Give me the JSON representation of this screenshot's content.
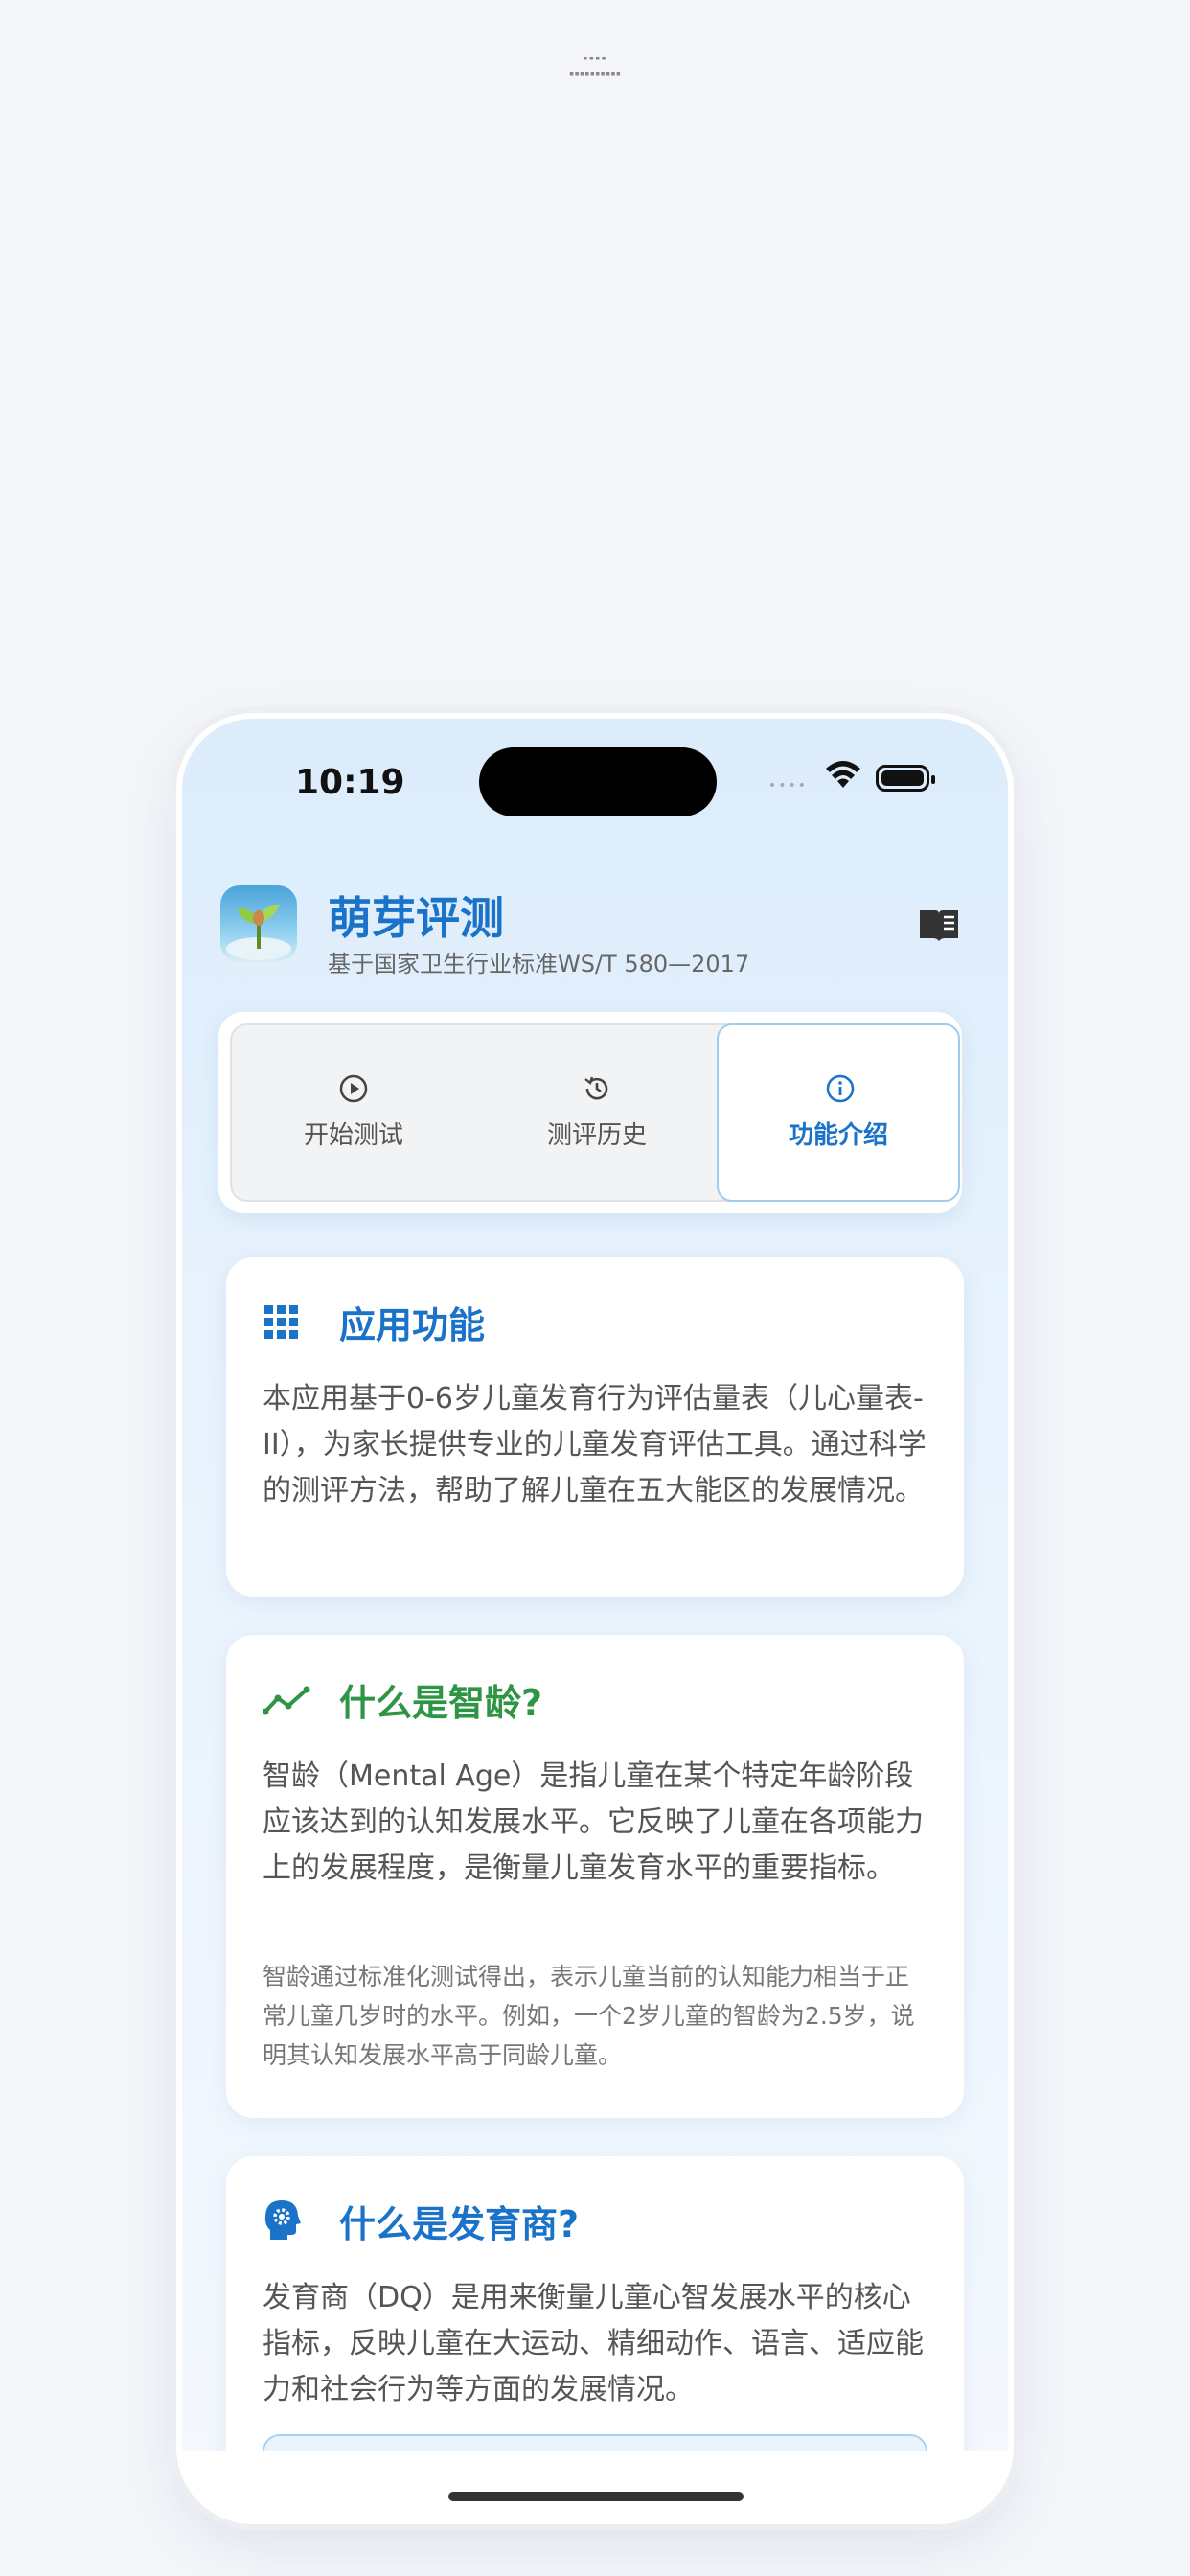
{
  "top_mark": {
    "line1": "▪▪▪▪",
    "line2": "▪▪▪▪▪▪▪▪▪▪"
  },
  "status_bar": {
    "time": "10:19",
    "signal_dots": "••••",
    "wifi_icon": "wifi-icon",
    "battery_icon": "battery-icon"
  },
  "header": {
    "title": "萌芽评测",
    "subtitle": "基于国家卫生行业标准WS/T 580—2017",
    "app_icon": "sprout-app-icon",
    "action_icon": "book-icon"
  },
  "tabs": [
    {
      "label": "开始测试",
      "icon": "play-circle-icon",
      "active": false
    },
    {
      "label": "测评历史",
      "icon": "history-icon",
      "active": false
    },
    {
      "label": "功能介绍",
      "icon": "info-icon",
      "active": true
    }
  ],
  "cards": {
    "features": {
      "title": "应用功能",
      "icon": "grid-icon",
      "body": "本应用基于0-6岁儿童发育行为评估量表（儿心量表-II），为家长提供专业的儿童发育评估工具。通过科学的测评方法，帮助了解儿童在五大能区的发展情况。"
    },
    "mental_age": {
      "title": "什么是智龄?",
      "icon": "trend-icon",
      "body": "智龄（Mental Age）是指儿童在某个特定年龄阶段应该达到的认知发展水平。它反映了儿童在各项能力上的发展程度，是衡量儿童发育水平的重要指标。",
      "note": "智龄通过标准化测试得出，表示儿童当前的认知能力相当于正常儿童几岁时的水平。例如，一个2岁儿童的智龄为2.5岁，说明其认知发展水平高于同龄儿童。"
    },
    "dq": {
      "title": "什么是发育商?",
      "icon": "brain-gear-icon",
      "body": "发育商（DQ）是用来衡量儿童心智发展水平的核心指标，反映儿童在大运动、精细动作、语言、适应能力和社会行为等方面的发展情况。"
    }
  },
  "colors": {
    "accent_blue": "#1a73c9",
    "accent_green": "#2e9544"
  }
}
